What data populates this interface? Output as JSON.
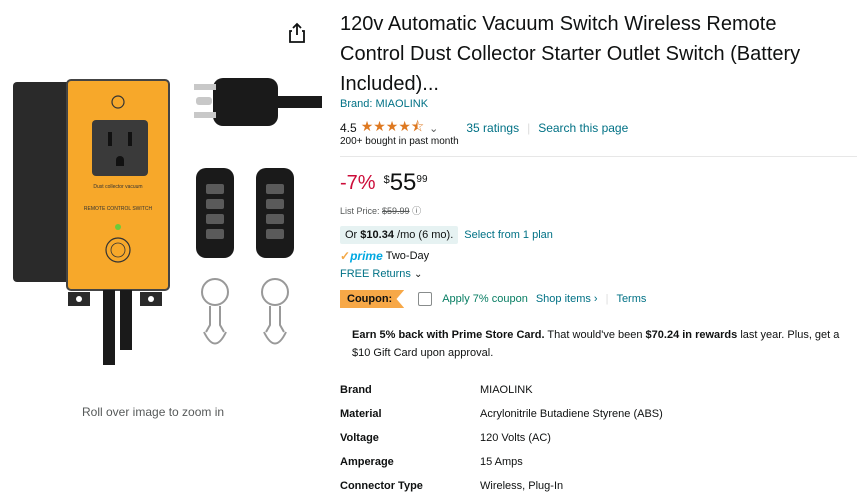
{
  "product": {
    "title": "120v Automatic Vacuum Switch Wireless Remote Control Dust Collector Starter Outlet Switch (Battery Included)...",
    "brand_link": "Brand: MIAOLINK",
    "rating_value": "4.5",
    "stars": "★★★★⯪",
    "ratings_count": "35 ratings",
    "search_page": "Search this page",
    "bought": "200+ bought in past month"
  },
  "price": {
    "discount": "-7%",
    "symbol": "$",
    "whole": "55",
    "fraction": "99",
    "list_label": "List Price:",
    "list_value": "$59.99"
  },
  "monthly": {
    "prefix": "Or",
    "amount": "$10.34",
    "suffix": "/mo (6 mo).",
    "plan_link": "Select from 1 plan"
  },
  "delivery": {
    "prime": "prime",
    "two_day": "Two-Day",
    "free_returns": "FREE Returns"
  },
  "coupon": {
    "badge": "Coupon:",
    "text": "Apply 7% coupon",
    "shop_items": "Shop items ›",
    "terms": "Terms"
  },
  "prime_card": {
    "bold1": "Earn 5% back with Prime Store Card.",
    "mid": " That would've been ",
    "bold2": "$70.24 in rewards",
    "tail": " last year. Plus, get a $10 Gift Card upon approval."
  },
  "specs": [
    {
      "key": "Brand",
      "value": "MIAOLINK"
    },
    {
      "key": "Material",
      "value": "Acrylonitrile Butadiene Styrene (ABS)"
    },
    {
      "key": "Voltage",
      "value": "120 Volts (AC)"
    },
    {
      "key": "Amperage",
      "value": "15 Amps"
    },
    {
      "key": "Connector Type",
      "value": "Wireless, Plug-In"
    }
  ],
  "image": {
    "zoom_hint": "Roll over image to zoom in",
    "label_top": "Dust collector vacuum",
    "label_mid": "REMOTE CONTROL SWITCH"
  },
  "colors": {
    "accent_orange": "#F7A82A",
    "link": "#007185",
    "discount": "#CC0C39",
    "coupon_green": "#067D62",
    "prime_blue": "#00A8E1"
  }
}
